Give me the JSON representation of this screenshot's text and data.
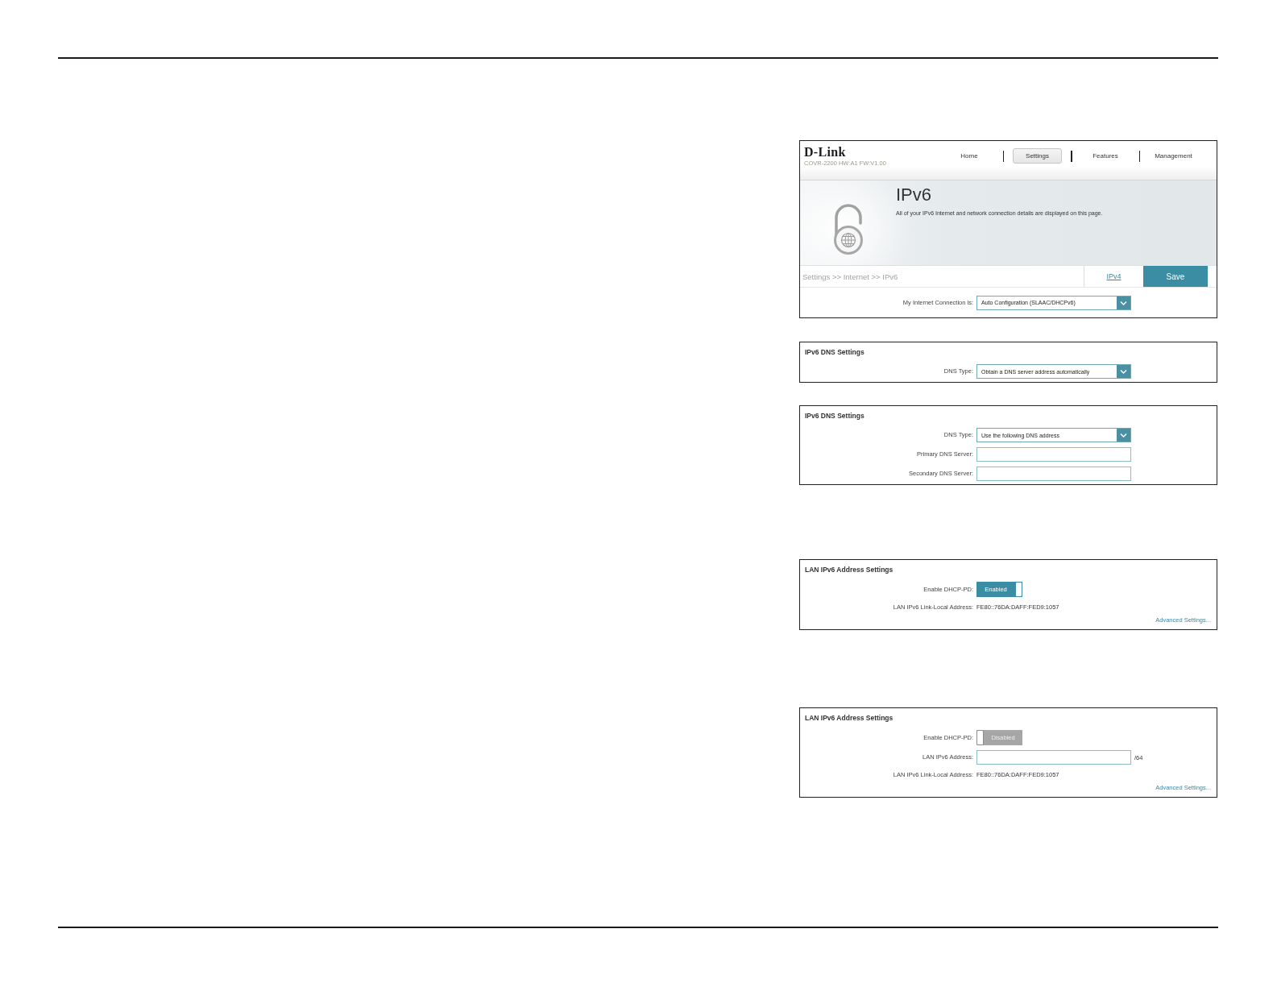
{
  "main_screen": {
    "logo": "D-Link",
    "model": "COVR-2200 HW:A1 FW:V1.00",
    "nav": [
      {
        "label": "Home",
        "selected": false
      },
      {
        "label": "Settings",
        "selected": true
      },
      {
        "label": "Features",
        "selected": false
      },
      {
        "label": "Management",
        "selected": false
      }
    ],
    "title": "IPv6",
    "description": "All of your IPv6 Internet and network connection details are displayed on this page.",
    "breadcrumb": "Settings >> Internet >> IPv6",
    "buttons": [
      {
        "kind": "link",
        "label": "IPv4"
      },
      {
        "kind": "primary",
        "label": "Save"
      }
    ],
    "fields": [
      {
        "kind": "select",
        "label": "My Internet Connection is:",
        "value": "Auto Configuration (SLAAC/DHCPv6)"
      }
    ]
  },
  "sections": [
    {
      "title": "IPv6 DNS Settings",
      "fields": [
        {
          "kind": "select",
          "label": "DNS Type:",
          "value": "Obtain a DNS server address automatically"
        }
      ]
    },
    {
      "title": "IPv6 DNS Settings",
      "fields": [
        {
          "kind": "select",
          "label": "DNS Type:",
          "value": "Use the following DNS address"
        },
        {
          "kind": "input",
          "label": "Primary DNS Server:"
        },
        {
          "kind": "input",
          "label": "Secondary DNS Server:"
        }
      ]
    },
    {
      "title": "LAN IPv6 Address Settings",
      "fields": [
        {
          "kind": "toggle",
          "label": "Enable DHCP-PD:",
          "on": true,
          "text": "Enabled"
        },
        {
          "kind": "text",
          "label": "LAN IPv6 Link-Local Address:",
          "value": "FE80::76DA:DAFF:FED9:1057"
        }
      ],
      "link": "Advanced Settings..."
    },
    {
      "title": "LAN IPv6 Address Settings",
      "fields": [
        {
          "kind": "toggle",
          "label": "Enable DHCP-PD:",
          "on": false,
          "text": "Disabled"
        },
        {
          "kind": "input",
          "label": "LAN IPv6 Address:",
          "suffix": "/64"
        },
        {
          "kind": "text",
          "label": "LAN IPv6 Link-Local Address:",
          "value": "FE80::76DA:DAFF:FED9:1057"
        }
      ],
      "link": "Advanced Settings..."
    }
  ]
}
